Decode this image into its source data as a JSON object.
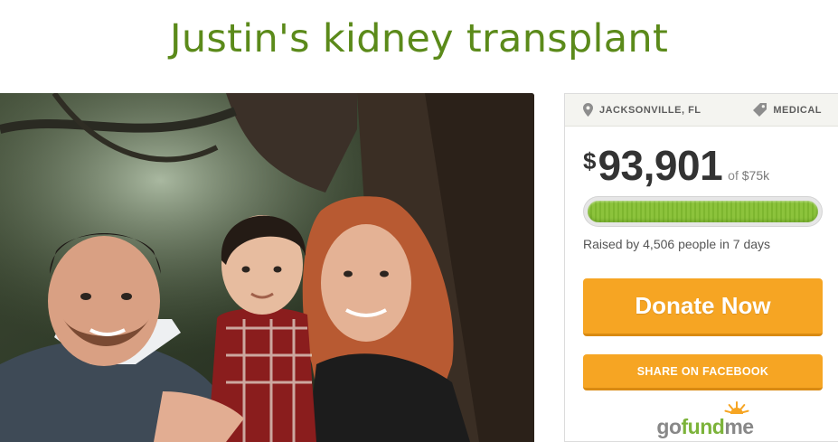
{
  "campaign": {
    "title": "Justin's kidney transplant"
  },
  "panel": {
    "location": "JACKSONVILLE, FL",
    "category": "MEDICAL",
    "currency_symbol": "$",
    "amount_raised": "93,901",
    "goal_prefix": "of",
    "goal": "$75k",
    "progress_fraction": 1.0,
    "raised_by": "Raised by 4,506 people in 7 days",
    "donate_label": "Donate Now",
    "share_label": "SHARE ON FACEBOOK",
    "logo_part1": "go",
    "logo_part2": "fund",
    "logo_part3": "me"
  },
  "colors": {
    "title": "#5b8a1a",
    "button": "#f6a523",
    "progress": "#8cc33c",
    "logo_green": "#7cb33a",
    "logo_sun": "#f6a523"
  },
  "icons": {
    "location": "map-pin-icon",
    "category": "tag-icon",
    "logo": "sunburst-icon"
  }
}
